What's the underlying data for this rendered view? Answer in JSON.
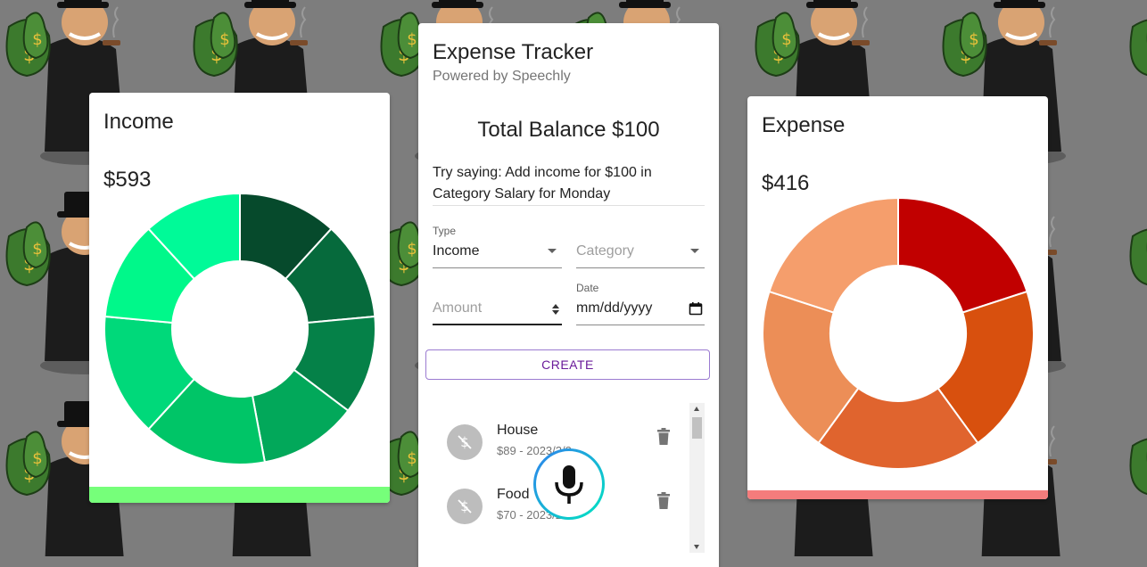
{
  "colors": {
    "income_bar": "#76ff7a",
    "expense_bar": "#f47c7c",
    "create_border": "#9b7bd1",
    "create_text": "#6a1b9a",
    "mic_gradient_start": "#2f80ed",
    "mic_gradient_end": "#00e5c0"
  },
  "income": {
    "title": "Income",
    "amount": "$593",
    "chart_data": {
      "type": "pie",
      "donut": true,
      "values": [
        1,
        1,
        1,
        1,
        1.25,
        1.25,
        1,
        1
      ],
      "colors": [
        "#064a2c",
        "#066a3c",
        "#058148",
        "#02a85a",
        "#00c567",
        "#00d97a",
        "#00f88a",
        "#00fa98"
      ]
    }
  },
  "expense": {
    "title": "Expense",
    "amount": "$416",
    "chart_data": {
      "type": "pie",
      "donut": true,
      "values": [
        1,
        1,
        1,
        1,
        1
      ],
      "colors": [
        "#c10000",
        "#d8500e",
        "#e0642e",
        "#ec8e57",
        "#f59e6c"
      ]
    }
  },
  "app": {
    "title": "Expense Tracker",
    "subtitle": "Powered by Speechly",
    "balance": "Total Balance $100",
    "hint": "Try saying: Add income for $100 in Category Salary for Monday",
    "form": {
      "type_label": "Type",
      "type_value": "Income",
      "category_placeholder": "Category",
      "amount_placeholder": "Amount",
      "date_label": "Date",
      "date_placeholder": "mm/dd/yyyy",
      "create_label": "CREATE"
    },
    "transactions": [
      {
        "name": "House",
        "detail": "$89 - 2023/2/3",
        "icon": "money-off-icon"
      },
      {
        "name": "Food",
        "detail": "$70 - 2023/2/3",
        "icon": "money-off-icon"
      }
    ]
  },
  "mic": {
    "icon": "microphone-icon"
  }
}
